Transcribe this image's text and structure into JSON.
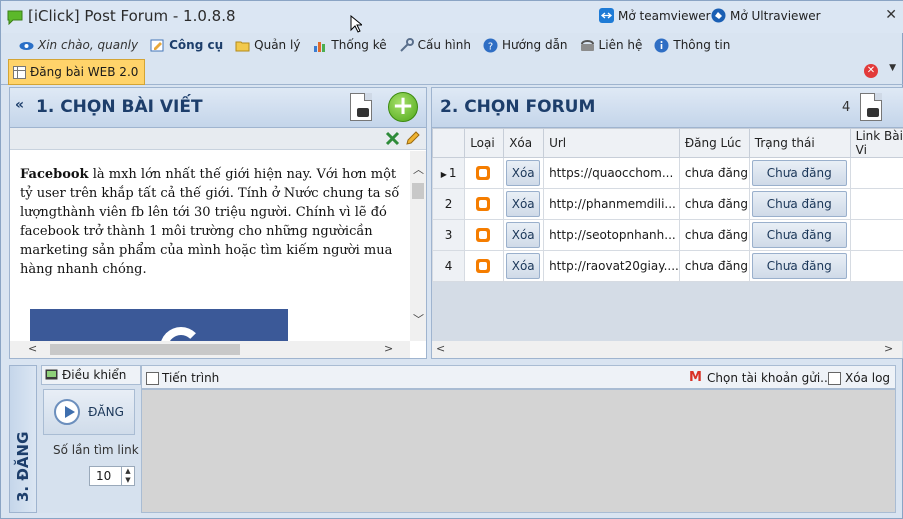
{
  "window": {
    "title": "[iClick] Post Forum - 1.0.8.8",
    "close_label": "✕"
  },
  "topright": {
    "teamviewer": "Mở teamviewer",
    "ultraviewer": "Mở Ultraviewer"
  },
  "menu": {
    "greeting": "Xin chào, quanly",
    "items": [
      "Công cụ",
      "Quản lý",
      "Thống kê",
      "Cấu hình",
      "Hướng dẫn",
      "Liên hệ",
      "Thông tin"
    ]
  },
  "tab": {
    "label": "Đăng bài WEB 2.0"
  },
  "panel1": {
    "collapse": "«",
    "title": "1. CHỌN BÀI VIẾT",
    "article_bold": "Facebook",
    "article_text": " là mxh lớn nhất thế giới hiện nay. Với hơn một tỷ user trên khắp tất cả thế giới. Tính ở Nước chung ta số lượngthành viên fb lên tới 30 triệu người. Chính vì lẽ đó facebook trở thành 1 môi trường cho những ngườicần marketing sản phẩm của mình hoặc tìm kiếm người mua hàng nhanh chóng."
  },
  "panel2": {
    "title": "2. CHỌN FORUM",
    "count": "4",
    "columns": [
      "Loại",
      "Xóa",
      "Url",
      "Đăng Lúc",
      "Trạng thái",
      "Link Bài Vi"
    ],
    "rows": [
      {
        "n": "1",
        "delete": "Xóa",
        "url": "https://quaocchom...",
        "time": "chưa đăng",
        "status": "Chưa đăng"
      },
      {
        "n": "2",
        "delete": "Xóa",
        "url": "http://phanmemdili...",
        "time": "chưa đăng",
        "status": "Chưa đăng"
      },
      {
        "n": "3",
        "delete": "Xóa",
        "url": "http://seotopnhanh...",
        "time": "chưa đăng",
        "status": "Chưa đăng"
      },
      {
        "n": "4",
        "delete": "Xóa",
        "url": "http://raovat20giay....",
        "time": "chưa đăng",
        "status": "Chưa đăng"
      }
    ]
  },
  "bottom": {
    "side_title": "3. ĐĂNG",
    "control_tab": "Điều khiển",
    "post_button": "ĐĂNG",
    "search_count_label": "Số lần tìm link",
    "search_count_value": "10",
    "progress_tab": "Tiến trình",
    "choose_account": "Chọn tài khoản gửi...",
    "clear_log": "Xóa log"
  }
}
